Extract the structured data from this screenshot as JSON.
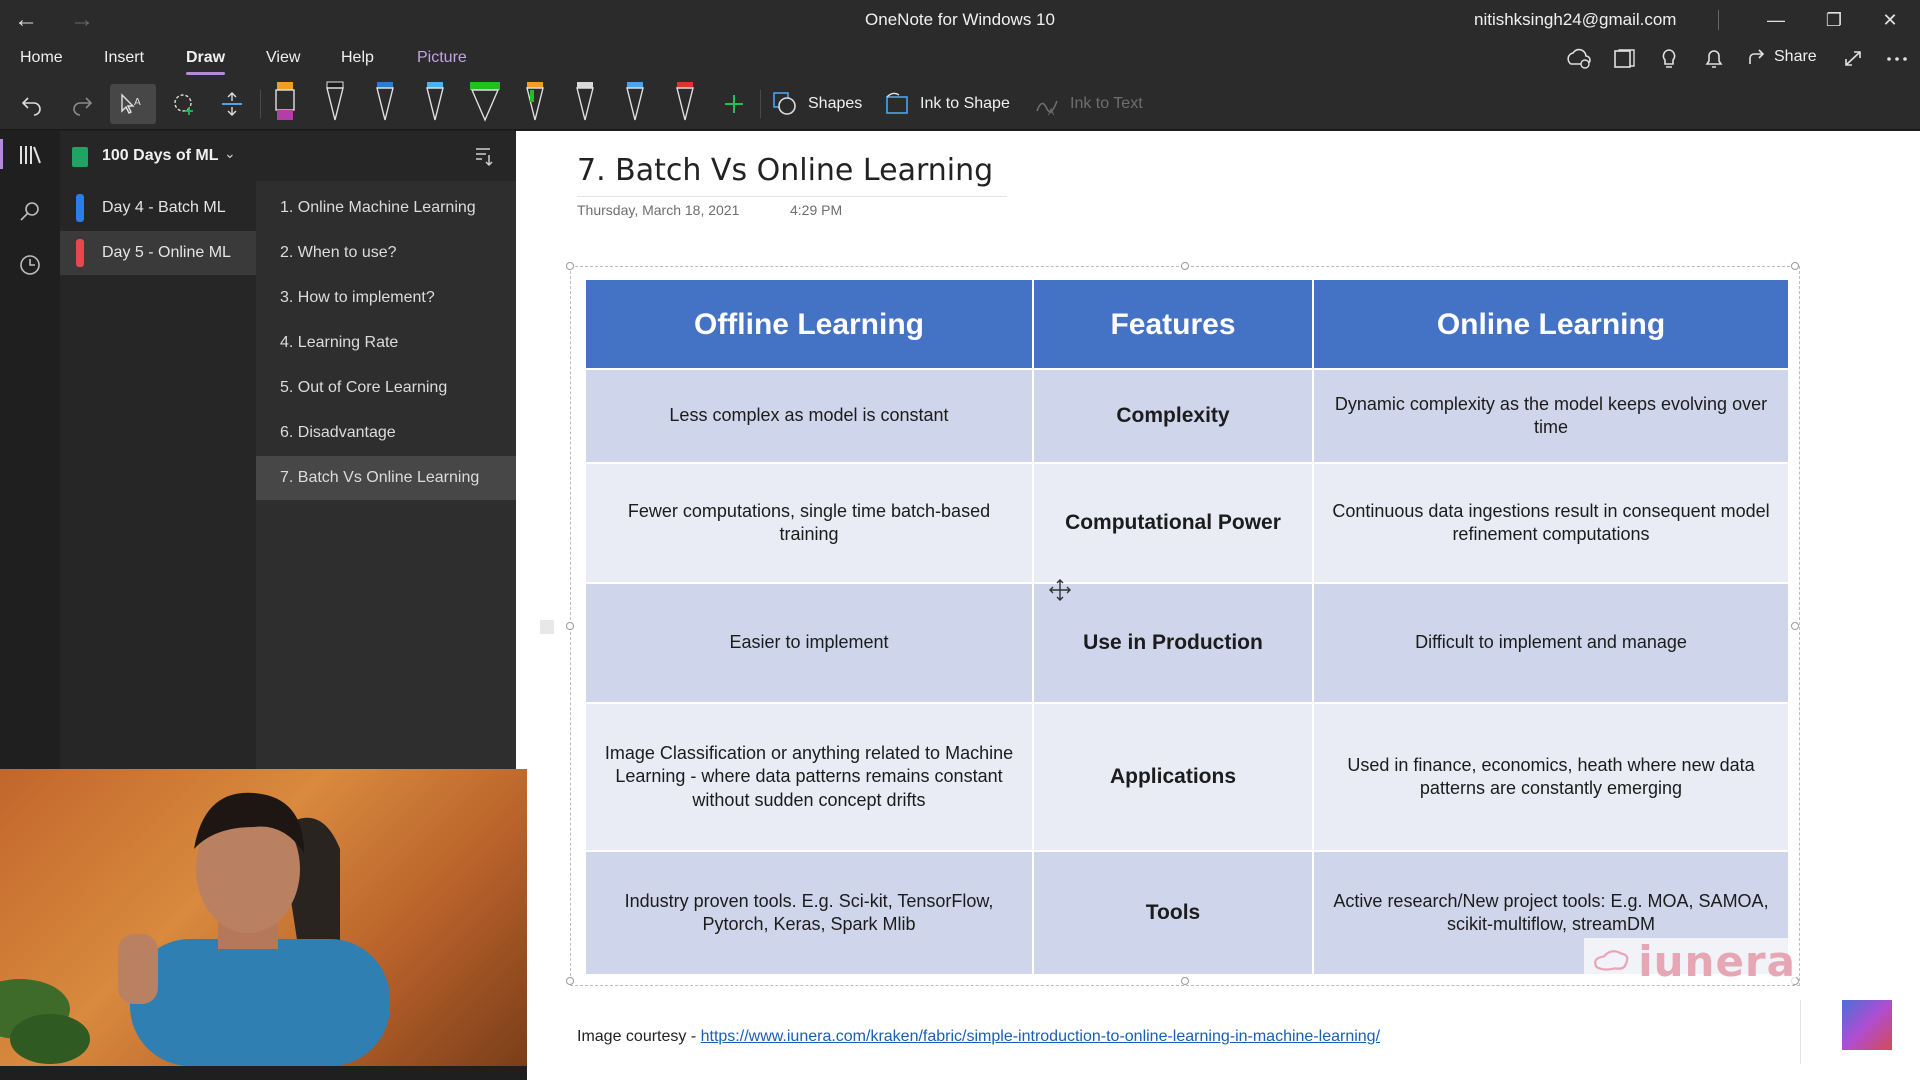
{
  "window": {
    "title": "OneNote for Windows 10",
    "account_email": "nitishksingh24@gmail.com"
  },
  "menu": {
    "items": [
      "Home",
      "Insert",
      "Draw",
      "View",
      "Help",
      "Picture"
    ],
    "active": "Draw",
    "share_label": "Share"
  },
  "ribbon": {
    "shapes_label": "Shapes",
    "ink_to_shape_label": "Ink to Shape",
    "ink_to_text_label": "Ink to Text",
    "pen_colors": [
      "#b33fa6",
      "#1a1a1a",
      "#2e7ad1",
      "#49b3f0",
      "#20c020",
      "#f0a020",
      "#d8d8d8",
      "#4aa3f0",
      "#e0322f"
    ]
  },
  "notebook": {
    "name": "100 Days of ML",
    "sections": [
      {
        "label": "Day 4 - Batch ML",
        "color": "#2b7de9"
      },
      {
        "label": "Day 5 - Online ML",
        "color": "#e8474b"
      }
    ],
    "pages": [
      "1. Online Machine Learning",
      "2. When to use?",
      "3. How to implement?",
      "4. Learning Rate",
      "5. Out of Core Learning",
      "6. Disadvantage",
      "7. Batch Vs Online Learning"
    ]
  },
  "page": {
    "title": "7. Batch Vs Online Learning",
    "date": "Thursday, March 18, 2021",
    "time": "4:29 PM",
    "courtesy_prefix": "Image courtesy - ",
    "courtesy_link": "https://www.iunera.com/kraken/fabric/simple-introduction-to-online-learning-in-machine-learning/"
  },
  "table": {
    "headers": [
      "Offline Learning",
      "Features",
      "Online Learning"
    ],
    "rows": [
      {
        "offline": "Less complex as model is constant",
        "feature": "Complexity",
        "online": "Dynamic complexity as the model keeps evolving over time"
      },
      {
        "offline": "Fewer computations, single time batch-based training",
        "feature": "Computational Power",
        "online": "Continuous data ingestions result in consequent model refinement computations"
      },
      {
        "offline": "Easier to implement",
        "feature": "Use in Production",
        "online": "Difficult to implement and manage"
      },
      {
        "offline": "Image Classification or anything related to Machine Learning - where data patterns remains constant without sudden concept drifts",
        "feature": "Applications",
        "online": "Used in finance, economics, heath where new data patterns are constantly emerging"
      },
      {
        "offline": "Industry proven tools. E.g. Sci-kit, TensorFlow, Pytorch, Keras, Spark Mlib",
        "feature": "Tools",
        "online": "Active research/New project tools: E.g. MOA, SAMOA, scikit-multiflow, streamDM"
      }
    ],
    "header_color": "#4472c4",
    "logo_text": "iunera"
  }
}
